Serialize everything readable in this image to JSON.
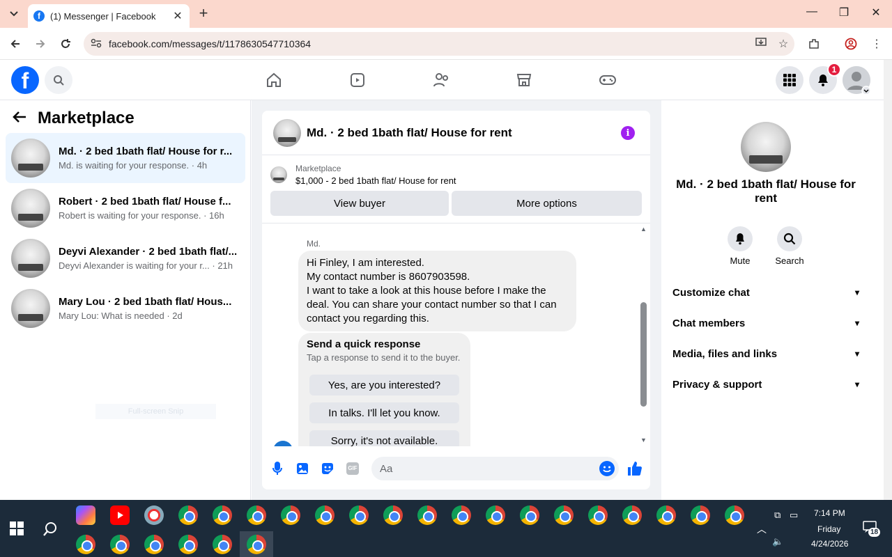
{
  "browser": {
    "tab_title": "(1) Messenger | Facebook",
    "url": "facebook.com/messages/t/1178630547710364"
  },
  "fb": {
    "notifications_count": "1"
  },
  "left": {
    "title": "Marketplace",
    "conversations": [
      {
        "name": "Md. · 2 bed 1bath flat/ House for r...",
        "preview": "Md. is waiting for your response. · 4h"
      },
      {
        "name": "Robert · 2 bed 1bath flat/ House f...",
        "preview": "Robert is waiting for your response. · 16h"
      },
      {
        "name": "Deyvi Alexander · 2 bed 1bath flat/...",
        "preview": "Deyvi Alexander is waiting for your r... · 21h"
      },
      {
        "name": "Mary Lou · 2 bed 1bath flat/ Hous...",
        "preview": "Mary Lou: What is needed · 2d"
      }
    ],
    "snip_label": "Full-screen Snip"
  },
  "chat": {
    "title": "Md. · 2 bed 1bath flat/ House for rent",
    "marketplace_label": "Marketplace",
    "listing": "$1,000 - 2 bed 1bath flat/ House for rent",
    "view_buyer": "View buyer",
    "more_options": "More options",
    "sender": "Md.",
    "message_lines": [
      "Hi Finley, I am interested.",
      "My contact number is 8607903598.",
      "I want to take a look at this house before I make the deal. You can share your contact number so that I can contact you regarding this."
    ],
    "quick_title": "Send a quick response",
    "quick_sub": "Tap a response to send it to the buyer.",
    "quick_replies": [
      "Yes, are you interested?",
      "In talks. I'll let you know.",
      "Sorry, it's not available."
    ],
    "placeholder": "Aa",
    "gif_label": "GIF"
  },
  "right": {
    "title": "Md. · 2 bed 1bath flat/ House for rent",
    "mute": "Mute",
    "search": "Search",
    "sections": [
      "Customize chat",
      "Chat members",
      "Media, files and links",
      "Privacy & support"
    ]
  },
  "taskbar": {
    "time": "7:14 PM",
    "day": "Friday",
    "date": "4/24/2026",
    "notif_count": "18"
  }
}
